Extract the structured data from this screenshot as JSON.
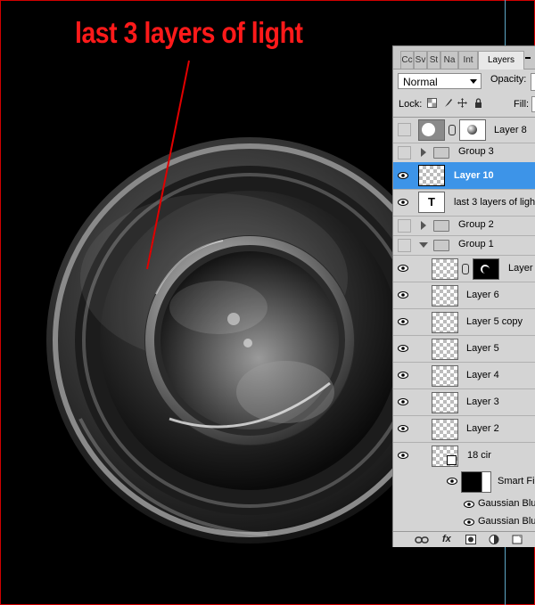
{
  "annotation": {
    "text": "last 3 layers of light",
    "color": "#ff1a1a"
  },
  "panel": {
    "tabs": [
      "Cc",
      "Sv",
      "St",
      "Na",
      "Int",
      "Layers"
    ],
    "active_tab": "Layers",
    "blend_mode": "Normal",
    "opacity_label": "Opacity:",
    "lock_label": "Lock:",
    "fill_label": "Fill:",
    "selection_color": "#3d94e8",
    "layers": [
      {
        "name": "Layer 8",
        "visible": false,
        "type": "masked-layer"
      },
      {
        "name": "Group 3",
        "visible": false,
        "type": "group-collapsed"
      },
      {
        "name": "Layer 10",
        "visible": true,
        "type": "layer",
        "selected": true
      },
      {
        "name": "last 3 layers of ligh",
        "visible": true,
        "type": "text"
      },
      {
        "name": "Group 2",
        "visible": false,
        "type": "group-collapsed"
      },
      {
        "name": "Group 1",
        "visible": false,
        "type": "group-expanded"
      },
      {
        "name": "Layer",
        "visible": true,
        "type": "masked-layer"
      },
      {
        "name": "Layer 6",
        "visible": true,
        "type": "layer"
      },
      {
        "name": "Layer 5 copy",
        "visible": true,
        "type": "layer"
      },
      {
        "name": "Layer 5",
        "visible": true,
        "type": "layer"
      },
      {
        "name": "Layer 4",
        "visible": true,
        "type": "layer"
      },
      {
        "name": "Layer 3",
        "visible": true,
        "type": "layer"
      },
      {
        "name": "Layer 2",
        "visible": true,
        "type": "layer"
      },
      {
        "name": "18 cir",
        "visible": true,
        "type": "smart-object"
      },
      {
        "name": "Smart Fil",
        "visible": true,
        "type": "smart-filters"
      },
      {
        "name": "Gaussian Blur",
        "visible": true,
        "type": "filter"
      },
      {
        "name": "Gaussian Blur",
        "visible": true,
        "type": "filter"
      }
    ],
    "bottom_icons": [
      "link-icon",
      "fx-icon",
      "mask-icon",
      "adjustment-icon",
      "new-layer-icon"
    ],
    "fx_label": "fx"
  }
}
